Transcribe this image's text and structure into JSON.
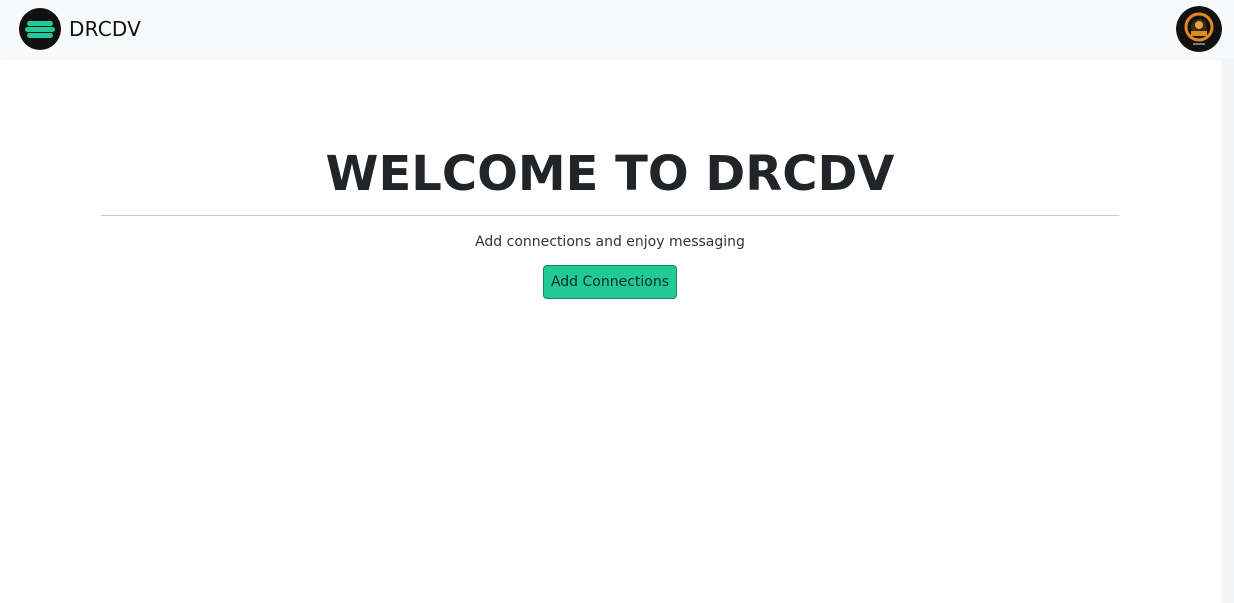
{
  "navbar": {
    "brand": "DRCDV",
    "logo_icon": "equals-logo-icon",
    "avatar_icon": "user-avatar-icon",
    "colors": {
      "background": "#f8f9fa",
      "logo_circle": "#111111",
      "logo_bars": "#20c997"
    }
  },
  "main": {
    "title": "WELCOME TO DRCDV",
    "subtitle": "Add connections and enjoy messaging",
    "add_button_label": "Add Connections",
    "colors": {
      "button_bg": "#20c997",
      "button_border": "#198754"
    }
  }
}
